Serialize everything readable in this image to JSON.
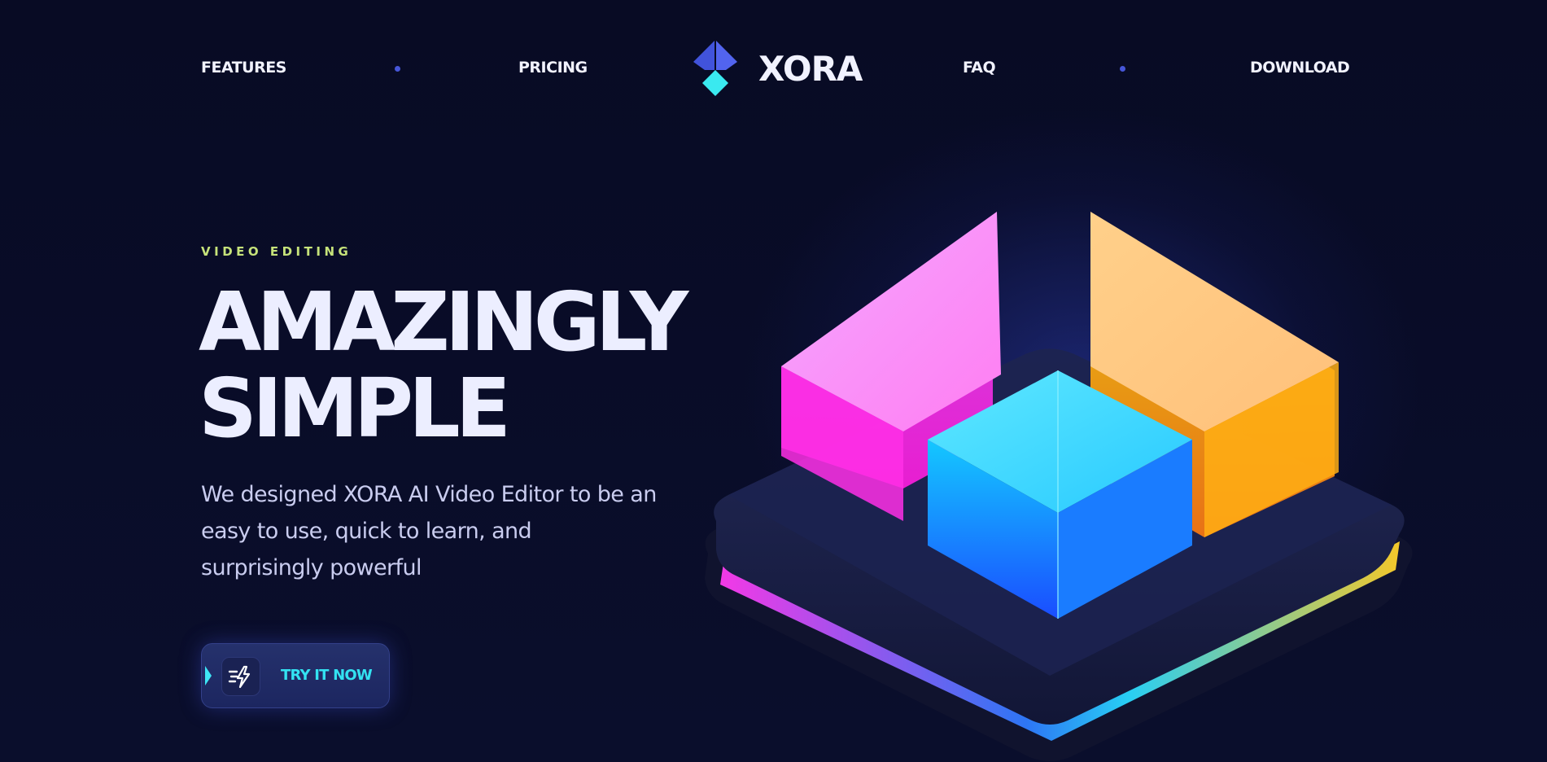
{
  "nav": {
    "links": [
      {
        "label": "FEATURES"
      },
      {
        "label": "PRICING"
      },
      {
        "label": "FAQ"
      },
      {
        "label": "DOWNLOAD"
      }
    ],
    "logo_text": "XORA",
    "logo_icon": "xora-diamond-logo"
  },
  "hero": {
    "eyebrow": "VIDEO EDITING",
    "headline_line1": "AMAZINGLY",
    "headline_line2": "SIMPLE",
    "subtitle": "We designed XORA AI Video Editor to be an easy to use, quick to learn, and surprisingly powerful",
    "cta_label": "TRY IT NOW",
    "cta_icon": "lightning-speed-icon",
    "illustration": "3d-glass-blocks-illustration"
  },
  "colors": {
    "background": "#080b24",
    "accent_cyan": "#33e2f1",
    "eyebrow_green": "#c6e37a",
    "logo_blue": "#4153db",
    "logo_cyan": "#3ae9f0",
    "nav_dot": "#4656d8",
    "text_primary": "#eceeff",
    "text_secondary": "#c9ccef"
  }
}
